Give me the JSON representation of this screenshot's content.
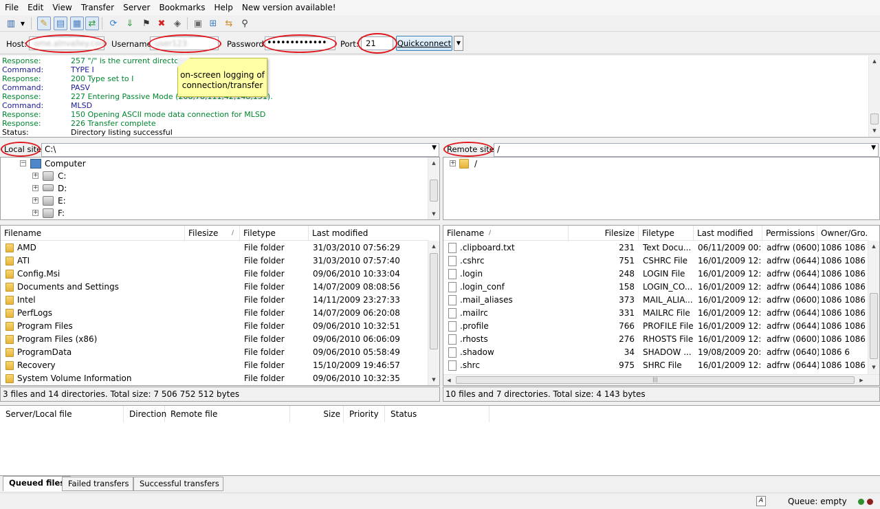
{
  "menu": [
    "File",
    "Edit",
    "View",
    "Transfer",
    "Server",
    "Bookmarks",
    "Help",
    "New version available!"
  ],
  "quickconnect": {
    "host_label": "Host:",
    "host_value": "ome.alnvalley.com",
    "username_label": "Username:",
    "username_value": "user123",
    "password_label": "Password:",
    "password_value": "•••••••••••••",
    "port_label": "Port:",
    "port_value": "21",
    "button_label": "Quickconnect"
  },
  "log": [
    {
      "kind": "Response:",
      "msg": "257 \"/\" is the current directory",
      "type": "resp"
    },
    {
      "kind": "Command:",
      "msg": "TYPE I",
      "type": "cmd"
    },
    {
      "kind": "Response:",
      "msg": "200 Type set to I",
      "type": "resp"
    },
    {
      "kind": "Command:",
      "msg": "PASV",
      "type": "cmd"
    },
    {
      "kind": "Response:",
      "msg": "227 Entering Passive Mode (208,78,111,42,148,151).",
      "type": "resp"
    },
    {
      "kind": "Command:",
      "msg": "MLSD",
      "type": "cmd"
    },
    {
      "kind": "Response:",
      "msg": "150 Opening ASCII mode data connection for MLSD",
      "type": "resp"
    },
    {
      "kind": "Response:",
      "msg": "226 Transfer complete",
      "type": "resp"
    },
    {
      "kind": "Status:",
      "msg": "Directory listing successful",
      "type": "stat"
    }
  ],
  "tooltip": {
    "line1": "on-screen logging of",
    "line2": "connection/transfer"
  },
  "local": {
    "site_label": "Local site:",
    "path": "C:\\",
    "tree": {
      "root": "Computer",
      "drives": [
        "C:",
        "D:",
        "E:",
        "F:"
      ]
    },
    "columns": [
      "Filename",
      "Filesize",
      "Filetype",
      "Last modified"
    ],
    "files": [
      {
        "name": "AMD",
        "size": "",
        "type": "File folder",
        "modified": "31/03/2010 07:56:29"
      },
      {
        "name": "ATI",
        "size": "",
        "type": "File folder",
        "modified": "31/03/2010 07:57:40"
      },
      {
        "name": "Config.Msi",
        "size": "",
        "type": "File folder",
        "modified": "09/06/2010 10:33:04"
      },
      {
        "name": "Documents and Settings",
        "size": "",
        "type": "File folder",
        "modified": "14/07/2009 08:08:56"
      },
      {
        "name": "Intel",
        "size": "",
        "type": "File folder",
        "modified": "14/11/2009 23:27:33"
      },
      {
        "name": "PerfLogs",
        "size": "",
        "type": "File folder",
        "modified": "14/07/2009 06:20:08"
      },
      {
        "name": "Program Files",
        "size": "",
        "type": "File folder",
        "modified": "09/06/2010 10:32:51"
      },
      {
        "name": "Program Files (x86)",
        "size": "",
        "type": "File folder",
        "modified": "09/06/2010 06:06:09"
      },
      {
        "name": "ProgramData",
        "size": "",
        "type": "File folder",
        "modified": "09/06/2010 05:58:49"
      },
      {
        "name": "Recovery",
        "size": "",
        "type": "File folder",
        "modified": "15/10/2009 19:46:57"
      },
      {
        "name": "System Volume Information",
        "size": "",
        "type": "File folder",
        "modified": "09/06/2010 10:32:35"
      }
    ],
    "status": "3 files and 14 directories. Total size: 7 506 752 512 bytes"
  },
  "remote": {
    "site_label": "Remote site:",
    "path": "/",
    "tree": {
      "root": "/"
    },
    "columns": [
      "Filename",
      "Filesize",
      "Filetype",
      "Last modified",
      "Permissions",
      "Owner/Gro..."
    ],
    "files": [
      {
        "name": ".clipboard.txt",
        "size": "231",
        "type": "Text Docu...",
        "modified": "06/11/2009 00:...",
        "perm": "adfrw (0600)",
        "owner": "1086 1086"
      },
      {
        "name": ".cshrc",
        "size": "751",
        "type": "CSHRC File",
        "modified": "16/01/2009 12:...",
        "perm": "adfrw (0644)",
        "owner": "1086 1086"
      },
      {
        "name": ".login",
        "size": "248",
        "type": "LOGIN File",
        "modified": "16/01/2009 12:...",
        "perm": "adfrw (0644)",
        "owner": "1086 1086"
      },
      {
        "name": ".login_conf",
        "size": "158",
        "type": "LOGIN_CO...",
        "modified": "16/01/2009 12:...",
        "perm": "adfrw (0644)",
        "owner": "1086 1086"
      },
      {
        "name": ".mail_aliases",
        "size": "373",
        "type": "MAIL_ALIA...",
        "modified": "16/01/2009 12:...",
        "perm": "adfrw (0600)",
        "owner": "1086 1086"
      },
      {
        "name": ".mailrc",
        "size": "331",
        "type": "MAILRC File",
        "modified": "16/01/2009 12:...",
        "perm": "adfrw (0644)",
        "owner": "1086 1086"
      },
      {
        "name": ".profile",
        "size": "766",
        "type": "PROFILE File",
        "modified": "16/01/2009 12:...",
        "perm": "adfrw (0644)",
        "owner": "1086 1086"
      },
      {
        "name": ".rhosts",
        "size": "276",
        "type": "RHOSTS File",
        "modified": "16/01/2009 12:...",
        "perm": "adfrw (0600)",
        "owner": "1086 1086"
      },
      {
        "name": ".shadow",
        "size": "34",
        "type": "SHADOW ...",
        "modified": "19/08/2009 20:...",
        "perm": "adfrw (0640)",
        "owner": "1086 6"
      },
      {
        "name": ".shrc",
        "size": "975",
        "type": "SHRC File",
        "modified": "16/01/2009 12:...",
        "perm": "adfrw (0644)",
        "owner": "1086 1086"
      }
    ],
    "status": "10 files and 7 directories. Total size: 4 143 bytes"
  },
  "queue": {
    "columns": [
      "Server/Local file",
      "Direction",
      "Remote file",
      "Size",
      "Priority",
      "Status"
    ],
    "tabs": [
      "Queued files",
      "Failed transfers",
      "Successful transfers"
    ]
  },
  "statusbar": {
    "queue": "Queue: empty"
  }
}
